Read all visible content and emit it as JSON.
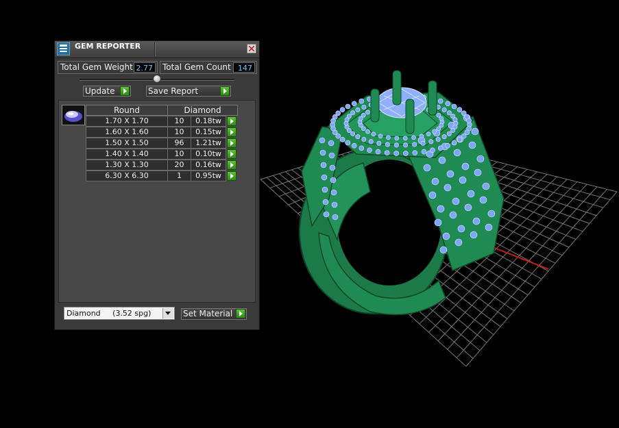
{
  "panel": {
    "title": "GEM REPORTER",
    "total_weight_label": "Total Gem Weight",
    "total_weight_value": "2.77",
    "total_count_label": "Total Gem Count",
    "total_count_value": "147",
    "update_label": "Update",
    "save_report_label": "Save Report",
    "columns": [
      "Round",
      "Diamond"
    ],
    "rows": [
      {
        "size": "1.70 X 1.70",
        "count": "10",
        "weight": "0.18tw"
      },
      {
        "size": "1.60 X 1.60",
        "count": "10",
        "weight": "0.15tw"
      },
      {
        "size": "1.50 X 1.50",
        "count": "96",
        "weight": "1.21tw"
      },
      {
        "size": "1.40 X 1.40",
        "count": "10",
        "weight": "0.10tw"
      },
      {
        "size": "1.30 X 1.30",
        "count": "20",
        "weight": "0.16tw"
      },
      {
        "size": "6.30 X 6.30",
        "count": "1",
        "weight": "0.95tw"
      }
    ],
    "material_select": "Diamond     (3.52 spg)",
    "set_material_label": "Set Material"
  },
  "icons": {
    "app": "gem-reporter-icon",
    "close": "close-icon",
    "gem": "round-gem-icon",
    "arrow": "green-play-arrow-icon"
  },
  "colors": {
    "ring": "#1f8a52",
    "gems": "#7fa6ff",
    "value_text": "#6fc3ff",
    "grid": "#8c8c8c",
    "axis_red": "#c81e1e"
  }
}
